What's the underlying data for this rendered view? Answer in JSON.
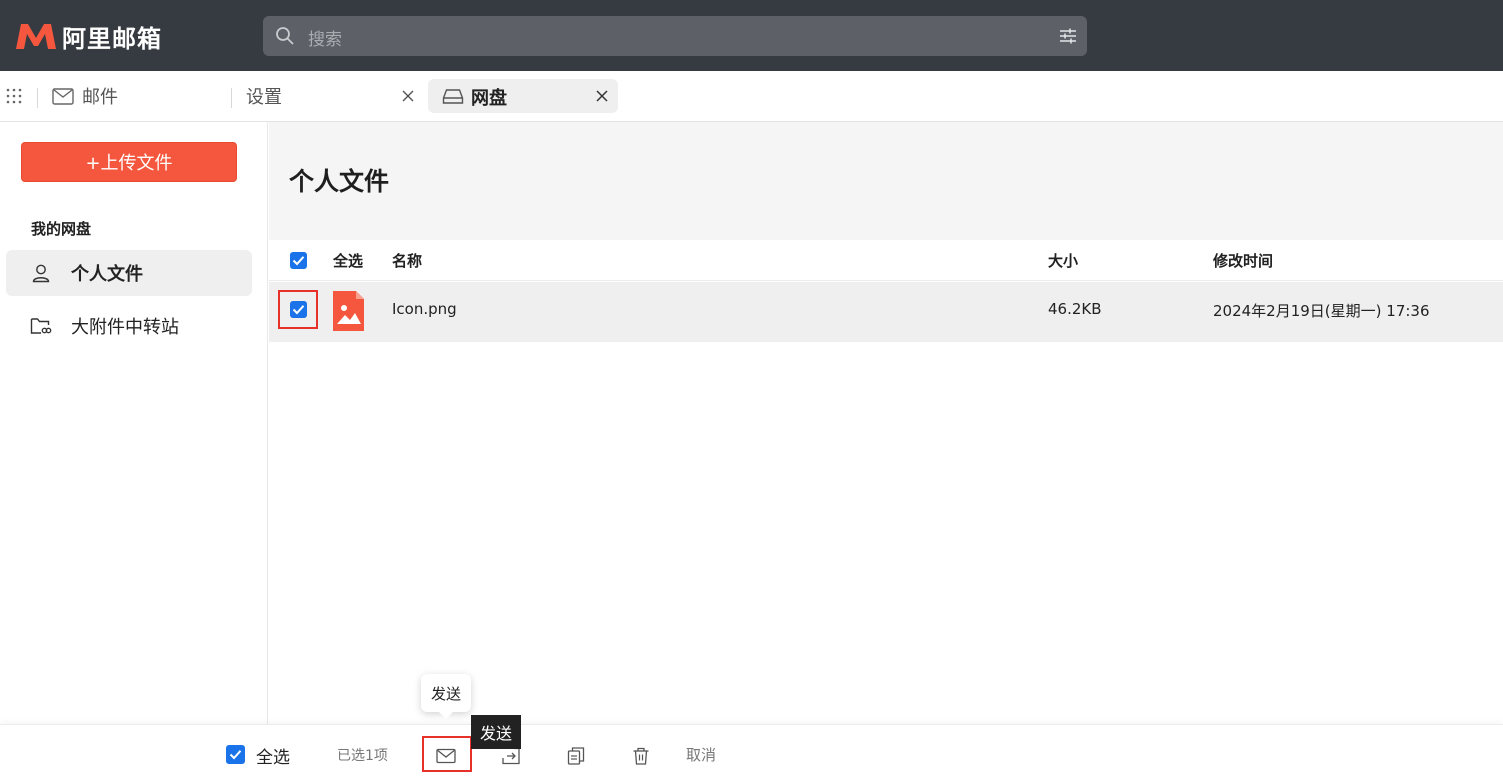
{
  "app": {
    "logo_text": "阿里邮箱",
    "brand_color": "#f4573d"
  },
  "search": {
    "placeholder": "搜索"
  },
  "tabs": [
    {
      "label": "邮件",
      "icon": "mail-icon"
    },
    {
      "label": "设置",
      "closable": true
    },
    {
      "label": "网盘",
      "icon": "drive-icon",
      "closable": true,
      "active": true
    }
  ],
  "sidebar": {
    "upload_label": "+上传文件",
    "section_title": "我的网盘",
    "items": [
      {
        "label": "个人文件",
        "icon": "user-icon",
        "active": true
      },
      {
        "label": "大附件中转站",
        "icon": "folder-link-icon",
        "active": false
      }
    ]
  },
  "main": {
    "title": "个人文件",
    "columns": {
      "select_all": "全选",
      "name": "名称",
      "size": "大小",
      "modified": "修改时间"
    },
    "rows": [
      {
        "name": "Icon.png",
        "size": "46.2KB",
        "modified": "2024年2月19日(星期一) 17:36",
        "checked": true,
        "icon": "image-file-icon"
      }
    ]
  },
  "bottombar": {
    "select_all": "全选",
    "selected_count": "已选1项",
    "actions": [
      "send-mail-icon",
      "move-icon",
      "copy-icon",
      "trash-icon"
    ],
    "cancel": "取消"
  },
  "tooltips": {
    "send_white": "发送",
    "send_dark": "发送"
  }
}
